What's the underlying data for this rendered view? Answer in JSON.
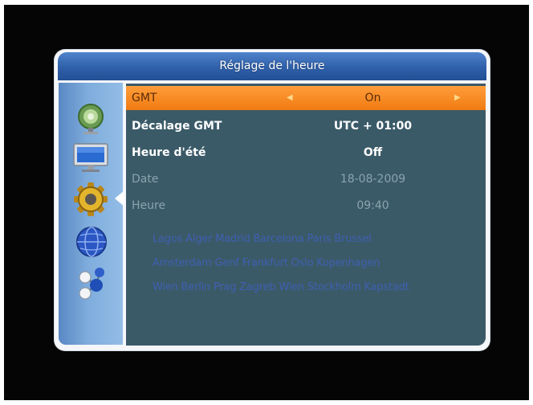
{
  "menu": {
    "title": "Réglage de l'heure",
    "rows": [
      {
        "label": "GMT",
        "value": "On",
        "selected": true
      },
      {
        "label": "Décalage GMT",
        "value": "UTC + 01:00"
      },
      {
        "label": "Heure d'été",
        "value": "Off"
      },
      {
        "label": "Date",
        "value": "18-08-2009",
        "disabled": true
      },
      {
        "label": "Heure",
        "value": "09:40",
        "disabled": true
      }
    ],
    "timezone_cities": [
      "Lagos Alger Madrid Barcelona Paris Brussel",
      "Amsterdam Genf Frankfurt Oslo Kopenhagen",
      "Wien Berlin Prag Zagreb Wien Stockholm Kapstadt"
    ]
  },
  "sidebar": {
    "items": [
      {
        "icon": "satellite-dish-icon"
      },
      {
        "icon": "tv-monitor-icon"
      },
      {
        "icon": "gear-icon",
        "active": true
      },
      {
        "icon": "globe-icon"
      },
      {
        "icon": "molecule-icon"
      }
    ]
  },
  "colors": {
    "title_bar": "#2f60aa",
    "content_bg": "#3b5a68",
    "selection": "#f07b12",
    "text_active": "#ffffff",
    "text_disabled": "#8aa2b0",
    "cities_text": "#3f5fb0"
  }
}
